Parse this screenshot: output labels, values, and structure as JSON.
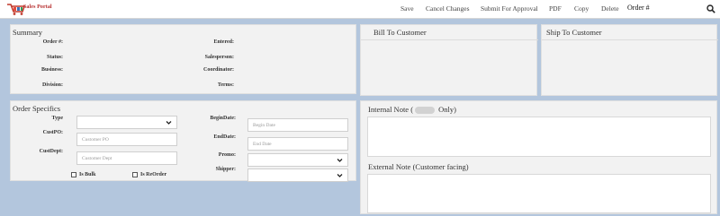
{
  "app": {
    "logo_text": "Sales Portal"
  },
  "menu": {
    "save": "Save",
    "cancel": "Cancel Changes",
    "submit": "Submit For Approval",
    "pdf": "PDF",
    "copy": "Copy",
    "delete": "Delete",
    "order": "Order #"
  },
  "summary": {
    "title": "Summary",
    "order_label": "Order #:",
    "status_label": "Status:",
    "business_label": "Business:",
    "division_label": "Division:",
    "entered_label": "Entered:",
    "salesperson_label": "Salesperson:",
    "coordinator_label": "Coordinator:",
    "terms_label": "Terms:"
  },
  "bill_to": {
    "title": "Bill To Customer"
  },
  "ship_to": {
    "title": "Ship To Customer"
  },
  "specifics": {
    "title": "Order Specifics",
    "type_label": "Type",
    "custpo_label": "CustPO:",
    "custpo_placeholder": "Customer PO",
    "custdept_label": "CustDept:",
    "custdept_placeholder": "Customer Dept",
    "begindate_label": "BeginDate:",
    "begindate_placeholder": "Begin Date",
    "enddate_label": "EndDate:",
    "enddate_placeholder": "End Date",
    "promo_label": "Promo:",
    "shipper_label": "Shipper:",
    "isbulk_label": "Is Bulk",
    "isreorder_label": "Is ReOrder"
  },
  "notes": {
    "internal_prefix": "Internal Note (",
    "internal_suffix": " Only)",
    "external_title": "External Note (Customer facing)"
  }
}
